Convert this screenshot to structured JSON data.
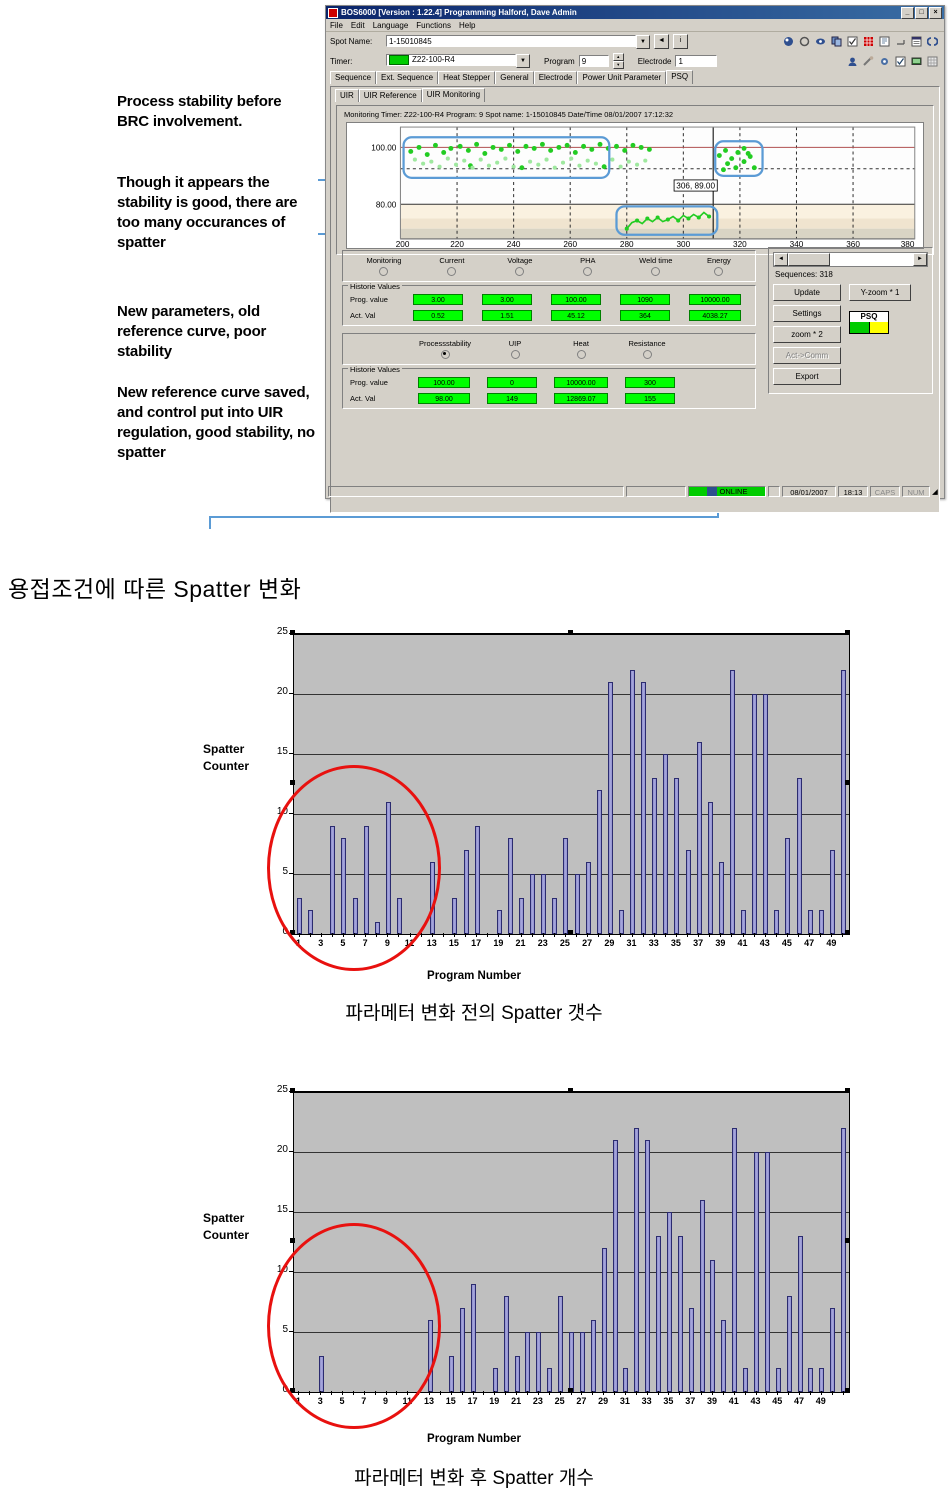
{
  "annotations": {
    "a1": "Process stability before BRC involvement.",
    "a2": "Though it appears the stability is good, there are too many occurances of spatter",
    "a3": "New parameters, old reference curve, poor stability",
    "a4": "New reference curve saved, and control put into UIR regulation, good stability, no spatter"
  },
  "app": {
    "title": "BOS6000 [Version : 1.22.4] Programming Halford, Dave Admin",
    "win_min": "_",
    "win_max": "□",
    "win_close": "×",
    "menu": [
      "File",
      "Edit",
      "Language",
      "Functions",
      "Help"
    ],
    "spot_name_label": "Spot Name:",
    "spot_name_value": "1-15010845",
    "timer_label": "Timer:",
    "timer_value": "Z22-100-R4",
    "program_label": "Program",
    "program_value": "9",
    "electrode_label": "Electrode",
    "electrode_value": "1",
    "tabs_main": [
      "Sequence",
      "Ext. Sequence",
      "Heat Stepper",
      "General",
      "Electrode",
      "Power Unit Parameter",
      "PSQ"
    ],
    "tabs_main_active": "PSQ",
    "tabs_sub": [
      "UIR",
      "UIR Reference",
      "UIR Monitoring"
    ],
    "tabs_sub_active": "UIR Monitoring",
    "monitor_header": "Monitoring Timer: Z22-100-R4 Program: 9 Spot name: 1-15010845 Date/Time 08/01/2007 17:12:32",
    "chart_y_labels": [
      "100.00",
      "80.00"
    ],
    "chart_x_labels": [
      "200",
      "220",
      "240",
      "260",
      "280",
      "300",
      "320",
      "340",
      "360",
      "380"
    ],
    "chart_tooltip": "306, 89.00",
    "group1_radios": [
      "Monitoring",
      "Current",
      "Voltage",
      "PHA",
      "Weld time",
      "Energy"
    ],
    "group1_selected": "",
    "group1_hist_title": "Historie Values",
    "group1_prog_label": "Prog. value",
    "group1_act_label": "Act. Val",
    "group1_prog_values": [
      "3.00",
      "3.00",
      "100.00",
      "1090",
      "10000.00"
    ],
    "group1_act_values": [
      "0.52",
      "1.51",
      "45.12",
      "364",
      "4038.27"
    ],
    "group2_radios": [
      "Processstability",
      "UIP",
      "Heat",
      "Resistance"
    ],
    "group2_selected": "Processstability",
    "group2_hist_title": "Historie Values",
    "group2_prog_label": "Prog. value",
    "group2_act_label": "Act. Val",
    "group2_prog_values": [
      "100.00",
      "0",
      "10000.00",
      "300"
    ],
    "group2_act_values": [
      "98.00",
      "149",
      "12869.07",
      "155"
    ],
    "sequences_label": "Sequences: 318",
    "btn_update": "Update",
    "btn_settings": "Settings",
    "btn_zoom2": "zoom * 2",
    "btn_actcomm": "Act->Comm",
    "btn_export": "Export",
    "btn_yzoom": "Y-zoom * 1",
    "psq_label": "PSQ",
    "psq_color_left": "#00cc00",
    "psq_color_right": "#ffff00",
    "status_online": "ONLINE",
    "status_date": "08/01/2007",
    "status_time": "18:13",
    "status_caps": "CAPS",
    "status_num": "NUM",
    "scroll_left": "◄",
    "scroll_right": "►"
  },
  "ko_title": "용접조건에 따른 Spatter 변화",
  "caption1": "파라메터 변화 전의 Spatter 갯수",
  "caption2": "파라메터 변화 후 Spatter 개수",
  "colors": {
    "bar_fill": "#9a9ad2",
    "bar_stroke": "#2b2b6f",
    "plot_bg": "#bfbfbf",
    "ellipse": "#e8110f",
    "leader": "#5b9bd5",
    "value_green": "#00ff00"
  },
  "chart_data": [
    {
      "id": "chart-before",
      "type": "bar",
      "title": "파라메터 변화 전의 Spatter 갯수",
      "xlabel": "Program Number",
      "ylabel": "Spatter Counter",
      "ylim": [
        0,
        25
      ],
      "yticks": [
        0,
        5,
        10,
        15,
        20,
        25
      ],
      "grid": true,
      "xticks": [
        1,
        3,
        5,
        7,
        9,
        11,
        13,
        15,
        17,
        19,
        21,
        23,
        25,
        27,
        29,
        31,
        33,
        35,
        37,
        39,
        41,
        43,
        45,
        47,
        49
      ],
      "annotation": "red ellipse highlighting programs 1-12 region",
      "categories": [
        1,
        2,
        3,
        4,
        5,
        6,
        7,
        8,
        9,
        10,
        11,
        12,
        13,
        14,
        15,
        16,
        17,
        18,
        19,
        20,
        21,
        22,
        23,
        24,
        25,
        26,
        27,
        28,
        29,
        30,
        31,
        32,
        33,
        34,
        35,
        36,
        37,
        38,
        39,
        40,
        41,
        42,
        43,
        44,
        45,
        46,
        47,
        48,
        49,
        50
      ],
      "values": [
        3,
        2,
        0,
        9,
        8,
        3,
        9,
        1,
        11,
        3,
        0,
        0,
        6,
        0,
        3,
        7,
        9,
        0,
        2,
        8,
        3,
        5,
        5,
        3,
        8,
        5,
        6,
        12,
        21,
        2,
        22,
        21,
        13,
        15,
        13,
        7,
        16,
        11,
        6,
        22,
        2,
        20,
        20,
        2,
        8,
        13,
        2,
        2,
        7,
        22
      ]
    },
    {
      "id": "chart-after",
      "type": "bar",
      "title": "파라메터 변화 후 Spatter 개수",
      "xlabel": "Program Number",
      "ylabel": "Spatter Counter",
      "ylim": [
        0,
        25
      ],
      "yticks": [
        0,
        5,
        10,
        15,
        20,
        25
      ],
      "grid": true,
      "xticks": [
        1,
        3,
        5,
        7,
        9,
        11,
        13,
        15,
        17,
        19,
        21,
        23,
        25,
        27,
        29,
        31,
        33,
        35,
        37,
        39,
        41,
        43,
        45,
        47,
        49
      ],
      "annotation": "red ellipse highlighting programs 1-12 region",
      "categories": [
        1,
        2,
        3,
        4,
        5,
        6,
        7,
        8,
        9,
        10,
        11,
        12,
        13,
        14,
        15,
        16,
        17,
        18,
        19,
        20,
        21,
        22,
        23,
        24,
        25,
        26,
        27,
        28,
        29,
        30,
        31,
        32,
        33,
        34,
        35,
        36,
        37,
        38,
        39,
        40,
        41,
        42,
        43,
        44,
        45,
        46,
        47,
        48,
        49,
        50
      ],
      "values": [
        0,
        0,
        3,
        0,
        0,
        0,
        0,
        0,
        0,
        0,
        0,
        0,
        6,
        0,
        3,
        7,
        9,
        0,
        2,
        8,
        3,
        5,
        5,
        2,
        8,
        5,
        5,
        6,
        12,
        21,
        2,
        22,
        21,
        13,
        15,
        13,
        7,
        16,
        11,
        6,
        22,
        2,
        20,
        20,
        2,
        8,
        13,
        2,
        2,
        7,
        22
      ]
    }
  ]
}
